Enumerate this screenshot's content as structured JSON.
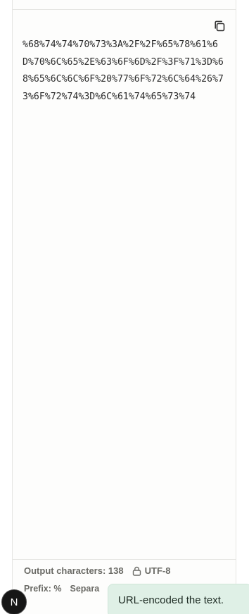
{
  "output": {
    "encoded_text": "%68%74%74%70%73%3A%2F%2F%65%78%61%6D%70%6C%65%2E%63%6F%6D%2F%3F%71%3D%68%65%6C%6C%6F%20%77%6F%72%6C%64%26%73%6F%72%74%3D%6C%61%74%65%73%74",
    "copy_icon": "copy-icon"
  },
  "footer": {
    "output_characters": "Output characters: 138",
    "encoding": "UTF-8",
    "encoding_icon": "lock-icon",
    "prefix": "Prefix: %",
    "separator_partial": "Separa"
  },
  "badge": {
    "letter": "N"
  },
  "toast": {
    "message": "URL-encoded the text."
  }
}
